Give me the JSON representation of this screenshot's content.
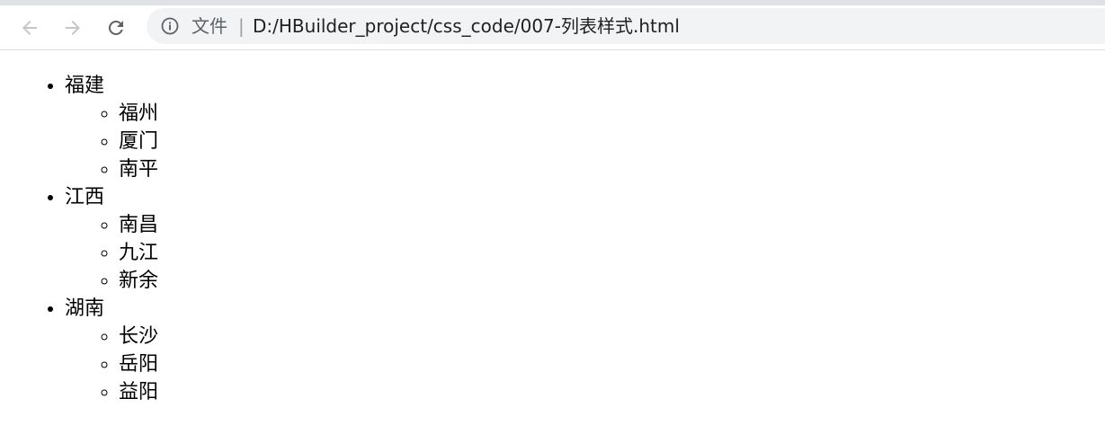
{
  "browser": {
    "back_icon": "arrow-left-icon",
    "forward_icon": "arrow-right-icon",
    "reload_icon": "reload-icon",
    "info_icon": "info-icon",
    "scheme_label": "文件",
    "separator": "|",
    "url": "D:/HBuilder_project/css_code/007-列表样式.html"
  },
  "page": {
    "provinces": [
      {
        "name": "福建",
        "cities": [
          "福州",
          "厦门",
          "南平"
        ]
      },
      {
        "name": "江西",
        "cities": [
          "南昌",
          "九江",
          "新余"
        ]
      },
      {
        "name": "湖南",
        "cities": [
          "长沙",
          "岳阳",
          "益阳"
        ]
      }
    ]
  }
}
